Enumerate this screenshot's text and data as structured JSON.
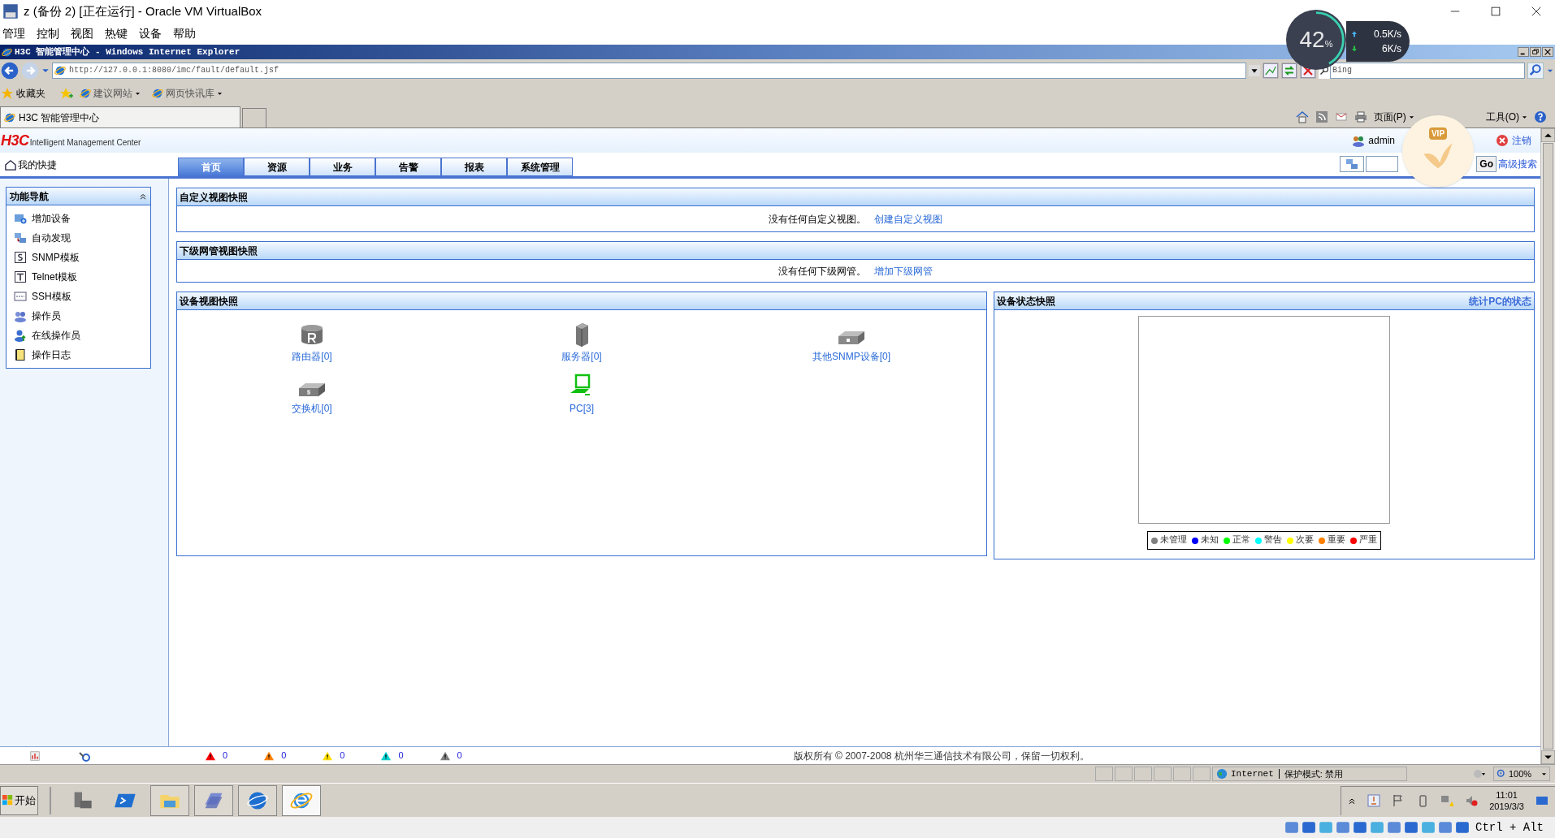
{
  "vbox": {
    "title": "z (备份 2) [正在运行] - Oracle VM VirtualBox",
    "menu": [
      "管理",
      "控制",
      "视图",
      "热键",
      "设备",
      "帮助"
    ]
  },
  "ie": {
    "title": "H3C 智能管理中心 - Windows Internet Explorer",
    "address": "http://127.0.0.1:8080/imc/fault/default.jsf",
    "search_placeholder": "Bing",
    "favorites_label": "收藏夹",
    "favorites": [
      "建议网站",
      "网页快讯库"
    ],
    "tabs": [
      {
        "label": "H3C 智能管理中心",
        "selected": true
      }
    ],
    "commands": [
      "页面(P)",
      "工具(O)"
    ]
  },
  "page": {
    "logo": "H3C",
    "logo_subtitle": "Intelligent Management Center",
    "user": "admin",
    "logout": "注销",
    "shortcuts": "我的快捷",
    "go": "Go",
    "advanced_search": "高级搜索",
    "nav_tabs": [
      {
        "label": "首页",
        "selected": true
      },
      {
        "label": "资源",
        "selected": false
      },
      {
        "label": "业务",
        "selected": false
      },
      {
        "label": "告警",
        "selected": false
      },
      {
        "label": "报表",
        "selected": false
      },
      {
        "label": "系统管理",
        "selected": false
      }
    ]
  },
  "sidebar": {
    "title": "功能导航",
    "items": [
      {
        "label": "增加设备",
        "kind": "add"
      },
      {
        "label": "自动发现",
        "kind": "discover"
      },
      {
        "label": "SNMP模板",
        "kind": "snmp"
      },
      {
        "label": "Telnet模板",
        "kind": "telnet"
      },
      {
        "label": "SSH模板",
        "kind": "ssh"
      },
      {
        "label": "操作员",
        "kind": "operators"
      },
      {
        "label": "在线操作员",
        "kind": "online"
      },
      {
        "label": "操作日志",
        "kind": "log"
      }
    ]
  },
  "custom_view": {
    "title": "自定义视图快照",
    "message": "没有任何自定义视图。",
    "link": "创建自定义视图"
  },
  "sub_nms": {
    "title": "下级网管视图快照",
    "message": "没有任何下级网管。",
    "link": "增加下级网管"
  },
  "device_view": {
    "title": "设备视图快照",
    "devices": [
      {
        "label": "路由器[0]",
        "kind": "router"
      },
      {
        "label": "服务器[0]",
        "kind": "server"
      },
      {
        "label": "其他SNMP设备[0]",
        "kind": "other"
      },
      {
        "label": "交换机[0]",
        "kind": "switch"
      },
      {
        "label": "PC[3]",
        "kind": "pc"
      }
    ]
  },
  "device_status": {
    "title": "设备状态快照",
    "link": "统计PC的状态",
    "legend": [
      {
        "label": "未管理",
        "color": "#808080"
      },
      {
        "label": "未知",
        "color": "#0000ff"
      },
      {
        "label": "正常",
        "color": "#00ff00"
      },
      {
        "label": "警告",
        "color": "#00ffff"
      },
      {
        "label": "次要",
        "color": "#ffff00"
      },
      {
        "label": "重要",
        "color": "#ff8000"
      },
      {
        "label": "严重",
        "color": "#ff0000"
      }
    ]
  },
  "footer": {
    "alarms": [
      {
        "count": "0",
        "color": "#ff0000"
      },
      {
        "count": "0",
        "color": "#ff8000"
      },
      {
        "count": "0",
        "color": "#ffe000"
      },
      {
        "count": "0",
        "color": "#00d0d0"
      },
      {
        "count": "0",
        "color": "#808080"
      }
    ],
    "copyright": "版权所有 © 2007-2008 杭州华三通信技术有限公司，保留一切权利。"
  },
  "ie_status": {
    "zone": "Internet",
    "protected_mode": "保护模式: 禁用",
    "zoom": "100%"
  },
  "taskbar": {
    "start": "开始",
    "time": "11:01",
    "date": "2019/3/3"
  },
  "vbox_status": {
    "host_key": "Ctrl + Alt"
  },
  "meter": {
    "percent": "42",
    "unit": "%",
    "level": 0.42,
    "up": "0.5K/s",
    "down": "6K/s"
  },
  "vip": {
    "label": "VIP"
  }
}
